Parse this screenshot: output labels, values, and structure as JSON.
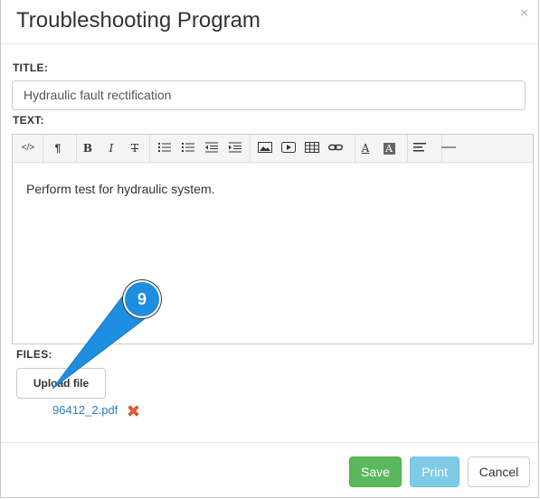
{
  "dialog": {
    "title": "Troubleshooting Program",
    "close_symbol": "×"
  },
  "form": {
    "title_label": "TITLE:",
    "title_value": "Hydraulic fault rectification",
    "text_label": "TEXT:",
    "body_text": "Perform test for hydraulic system.",
    "files_label": "FILES:"
  },
  "toolbar": {
    "buttons": [
      {
        "icon": "code-view-icon",
        "glyph": "</>"
      },
      {
        "icon": "paragraph-style-icon",
        "glyph": "¶"
      },
      {
        "icon": "bold-icon",
        "glyph": "B"
      },
      {
        "icon": "italic-icon",
        "glyph": "I"
      },
      {
        "icon": "strikethrough-icon",
        "glyph": "T"
      },
      {
        "icon": "unordered-list-icon"
      },
      {
        "icon": "ordered-list-icon"
      },
      {
        "icon": "outdent-icon"
      },
      {
        "icon": "indent-icon"
      },
      {
        "icon": "insert-image-icon"
      },
      {
        "icon": "insert-video-icon"
      },
      {
        "icon": "insert-table-icon"
      },
      {
        "icon": "insert-link-icon"
      },
      {
        "icon": "font-color-icon",
        "glyph": "A"
      },
      {
        "icon": "background-color-icon",
        "glyph": "A"
      },
      {
        "icon": "align-icon"
      },
      {
        "icon": "horizontal-line-icon"
      }
    ]
  },
  "files": {
    "upload_label": "Upload file",
    "items": [
      {
        "name": "96412_2.pdf"
      }
    ]
  },
  "footer": {
    "save_label": "Save",
    "print_label": "Print",
    "cancel_label": "Cancel"
  },
  "annotation": {
    "step_number": "9",
    "color": "#1e8ee0"
  },
  "colors": {
    "save": "#5cb85c",
    "print": "#7fcbe6",
    "link": "#2a7fc5"
  }
}
